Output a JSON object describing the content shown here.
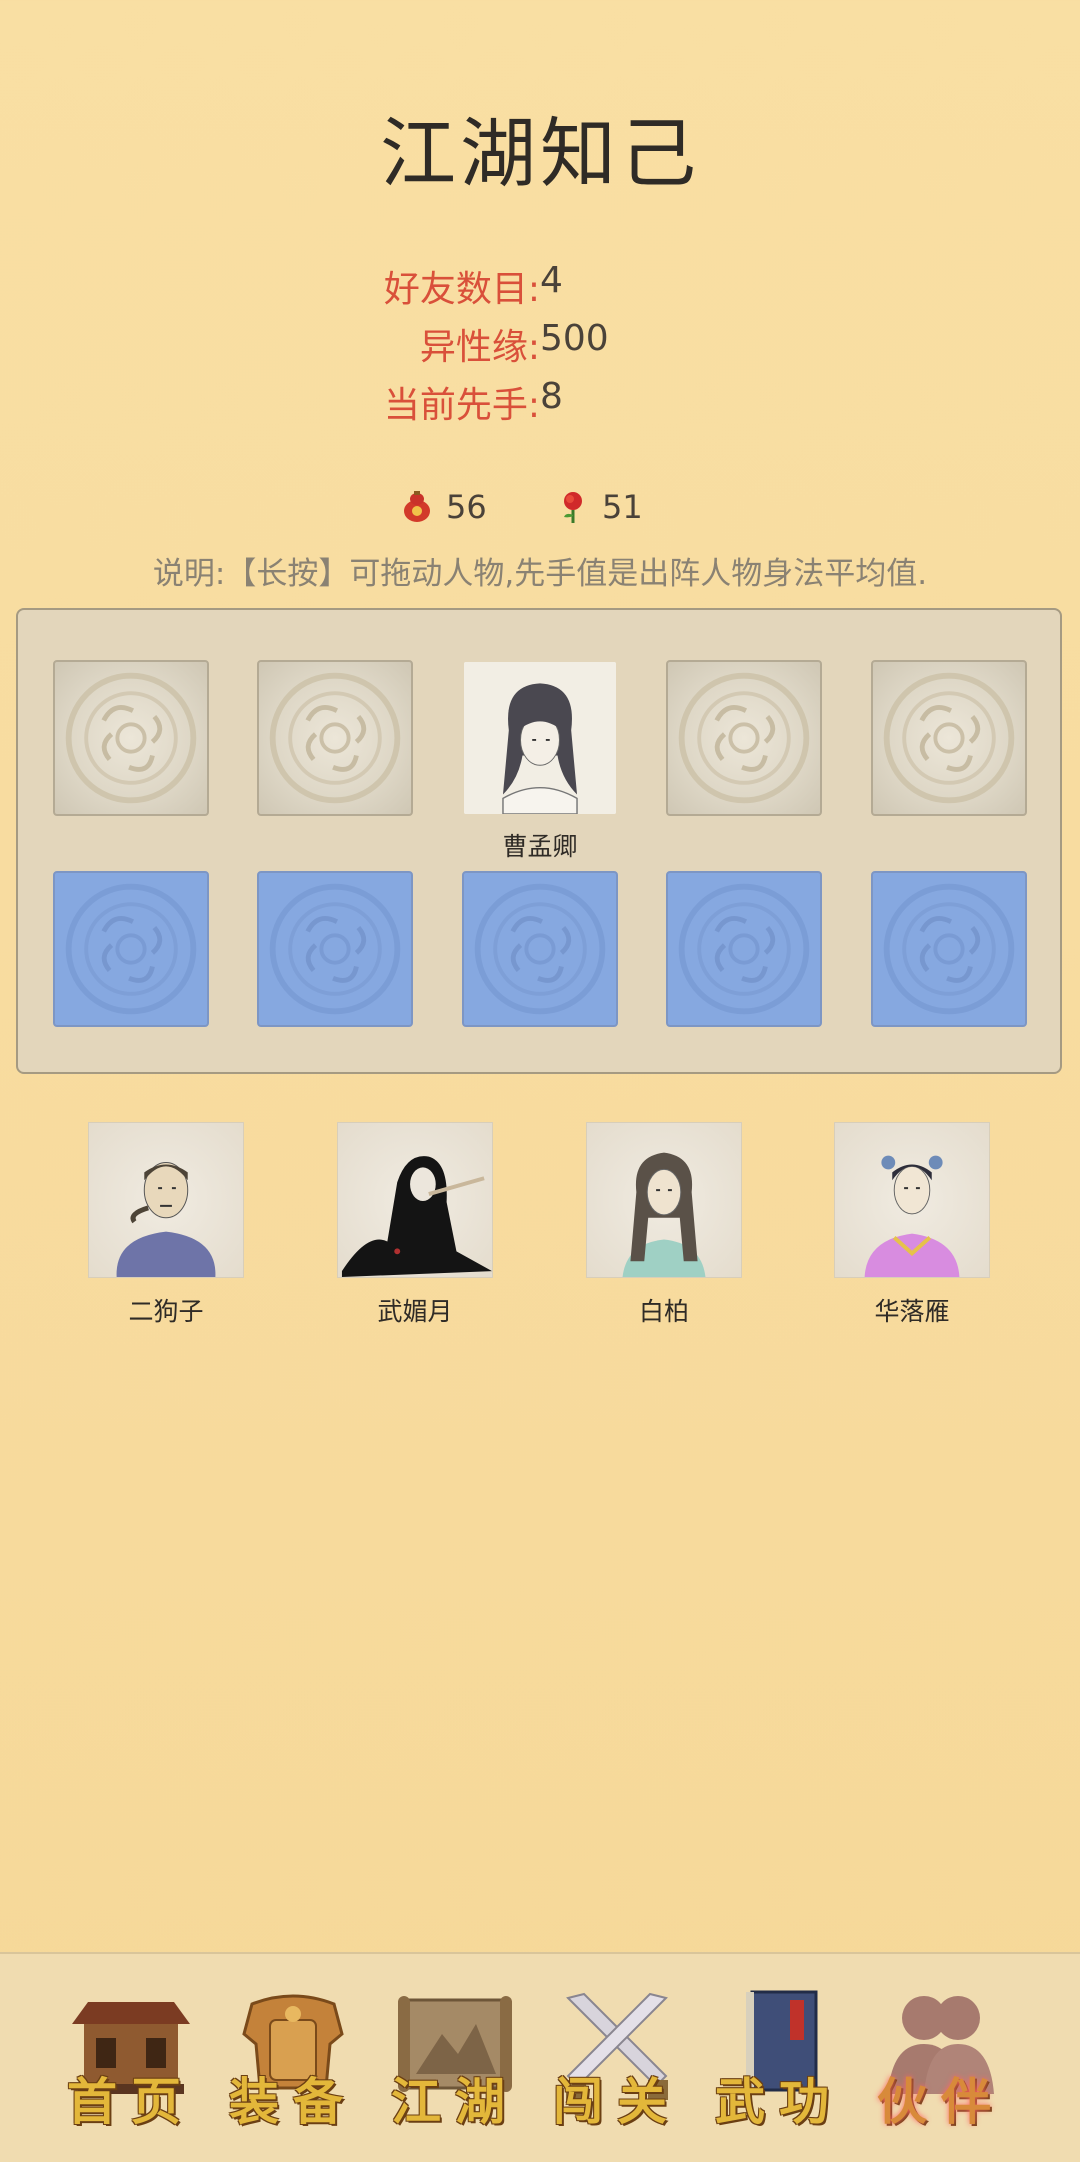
{
  "title": "江湖知己",
  "stats": {
    "friends_label": "好友数目:",
    "friends_value": "4",
    "affinity_label": "异性缘:",
    "affinity_value": "500",
    "initiative_label": "当前先手:",
    "initiative_value": "8"
  },
  "resources": {
    "gourd_count": "56",
    "rose_count": "51"
  },
  "note": "说明:【长按】可拖动人物,先手值是出阵人物身法平均值.",
  "formation": {
    "front_row": [
      "",
      "",
      "曹孟卿",
      "",
      ""
    ]
  },
  "bench": [
    {
      "name": "二狗子"
    },
    {
      "name": "武媚月"
    },
    {
      "name": "白柏"
    },
    {
      "name": "华落雁"
    }
  ],
  "nav": [
    {
      "label": "首页",
      "icon": "house-icon"
    },
    {
      "label": "装备",
      "icon": "armor-icon"
    },
    {
      "label": "江湖",
      "icon": "scroll-map-icon"
    },
    {
      "label": "闯关",
      "icon": "crossed-swords-icon"
    },
    {
      "label": "武功",
      "icon": "book-icon"
    },
    {
      "label": "伙伴",
      "icon": "partners-icon",
      "active": true
    }
  ],
  "colors": {
    "accent_label": "#d9503a",
    "water_slot": "#86a8e0",
    "nav_text": "#e3b73a"
  }
}
